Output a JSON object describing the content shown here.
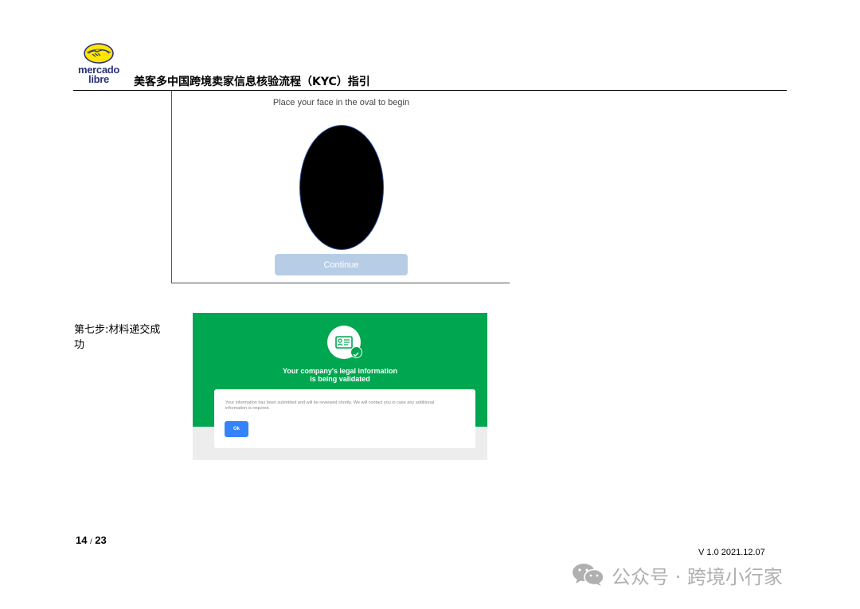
{
  "header": {
    "logo_line1": "mercado",
    "logo_line2": "libre",
    "title": "美客多中国跨境卖家信息核验流程（KYC）指引"
  },
  "face_capture": {
    "prompt": "Place your face in the oval to begin",
    "continue_label": "Continue"
  },
  "step": {
    "label": "第七步:材料递交成功"
  },
  "validation": {
    "title_line1": "Your company's legal information",
    "title_line2": "is being validated",
    "message": "Your information has been submitted and will be reviewed shortly. We will contact you in case any additional information is required.",
    "ok_label": "Ok"
  },
  "footer": {
    "page_current": "14",
    "page_separator": "/",
    "page_total": "23",
    "version": "V 1.0  2021.12.07",
    "watermark": "公众号 · 跨境小行家"
  },
  "colors": {
    "brand_green": "#00a650",
    "button_blue": "#3483fa",
    "disabled_button": "#b7cde6",
    "logo_yellow": "#ffe600",
    "logo_navy": "#2d3277"
  },
  "icons": [
    "handshake-logo-icon",
    "id-card-icon",
    "check-icon",
    "wechat-icon"
  ]
}
